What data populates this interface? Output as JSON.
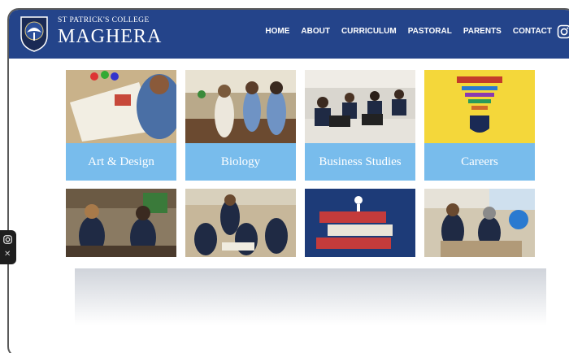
{
  "header": {
    "school_small": "ST PATRICK'S COLLEGE",
    "school_big": "MAGHERA",
    "nav": [
      "HOME",
      "ABOUT",
      "CURRICULUM",
      "PASTORAL",
      "PARENTS",
      "CONTACT"
    ],
    "background": "#24448a"
  },
  "tiles": [
    {
      "label": "Art & Design"
    },
    {
      "label": "Biology"
    },
    {
      "label": "Business Studies"
    },
    {
      "label": "Careers"
    }
  ],
  "accent": "#78bcec"
}
